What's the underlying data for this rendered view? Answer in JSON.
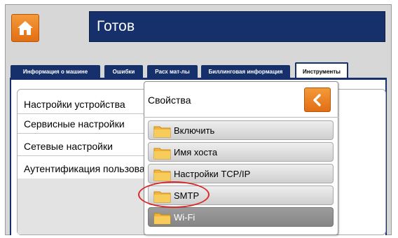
{
  "header": {
    "home_icon": "home-icon",
    "title": "Готов"
  },
  "tabs": [
    {
      "label": "Информация о машине",
      "active": false
    },
    {
      "label": "Ошибки",
      "active": false
    },
    {
      "label": "Расх мат-лы",
      "active": false
    },
    {
      "label": "Биллинговая информация",
      "active": false
    },
    {
      "label": "Инструменты",
      "active": true
    }
  ],
  "settings": {
    "items": [
      {
        "label": "Настройки устройства"
      },
      {
        "label": "Сервисные настройки"
      },
      {
        "label": "Сетевые настройки"
      },
      {
        "label": "Аутентификация пользователя"
      }
    ]
  },
  "popup": {
    "title": "Свойства",
    "back_icon": "chevron-left-icon",
    "items": [
      {
        "label": "Включить",
        "icon": "folder-icon",
        "selected": false
      },
      {
        "label": "Имя хоста",
        "icon": "folder-icon",
        "selected": false
      },
      {
        "label": "Настройки TCP/IP",
        "icon": "folder-icon",
        "selected": false
      },
      {
        "label": "SMTP",
        "icon": "folder-icon",
        "selected": false,
        "highlighted": true
      },
      {
        "label": "Wi-Fi",
        "icon": "folder-icon",
        "selected": true
      }
    ]
  },
  "colors": {
    "accent_orange": "#e8801f",
    "navy": "#15306b",
    "highlight_red": "#d72a2a"
  }
}
